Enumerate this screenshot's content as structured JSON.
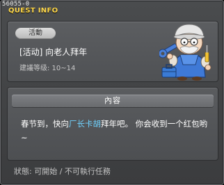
{
  "window": {
    "id_label": "56055-0",
    "title": "QUEST INFO"
  },
  "quest": {
    "badge": "活動",
    "name": "[活动] 向老人拜年",
    "level": "建議等级: 10~14"
  },
  "content": {
    "header": "內容",
    "desc_before": "春节到，快向",
    "npc_name": "厂长卡胡",
    "desc_after": "拜年吧。 你会收到一个红包哟~"
  },
  "status": {
    "text": "狀態: 可開始 / 不可執行任務"
  },
  "icons": {
    "npc": "old-man-mechanic-portrait"
  },
  "colors": {
    "title": "#ffd84a",
    "npc_highlight": "#6fd2ff"
  }
}
